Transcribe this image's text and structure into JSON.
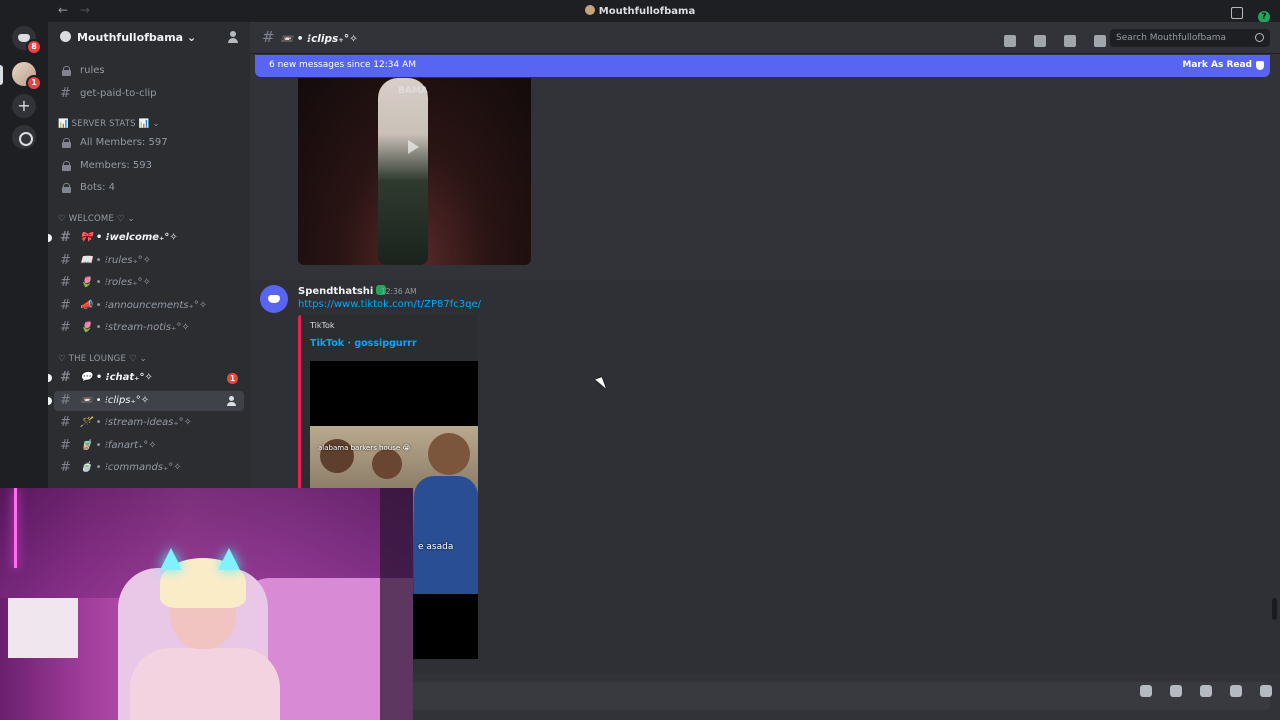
{
  "titlebar": {
    "title": "Mouthfullofbama",
    "back": "←",
    "forward": "→",
    "help": "?"
  },
  "guilds": {
    "home_badge": "8",
    "server_badge": "1",
    "add": "+"
  },
  "server": {
    "name": "Mouthfullofbama",
    "chevron": "⌄"
  },
  "sidebar": {
    "top_channels": [
      {
        "name": "rules"
      },
      {
        "name": "get-paid-to-clip"
      }
    ],
    "server_stats_category": "📊 SERVER STATS 📊 ⌄",
    "stats": [
      "All Members: 597",
      "Members: 593",
      "Bots: 4"
    ],
    "welcome_category": "♡ WELCOME ♡ ⌄",
    "welcome_channels": [
      "🎀 • ⁝welcome₊°✧",
      "📖 • ⁝rules₊°✧",
      "🌷 • ⁝roles₊°✧",
      "📣 • ⁝announcements₊°✧",
      "🌷 • ⁝stream-notis₊°✧"
    ],
    "lounge_category": "♡ THE LOUNGE ♡ ⌄",
    "lounge_channels": [
      "💬 • ⁝chat₊°✧",
      "📼 • ⁝clips₊°✧",
      "🪄 • ⁝stream-ideas₊°✧",
      "🧋 • ⁝fanart₊°✧",
      "🍵 • ⁝commands₊°✧"
    ],
    "chat_mentions": "1"
  },
  "header": {
    "channel": "📼 • ⁝clips₊°✧",
    "search_placeholder": "Search Mouthfullofbama"
  },
  "new_messages_bar": {
    "text": "6 new messages since 12:34 AM",
    "action": "Mark As Read"
  },
  "message": {
    "author": "Spendthatshi",
    "timestamp": "12:36 AM",
    "link": "https://www.tiktok.com/t/ZP87fc3qe/",
    "embed_provider": "TikTok",
    "embed_title": "TikTok · gossipgurrr",
    "video_caption_top": "alabama barkers house 😭",
    "video_caption_bottom": "e asada"
  },
  "first_image": {
    "overlay_text": "BAMA"
  }
}
